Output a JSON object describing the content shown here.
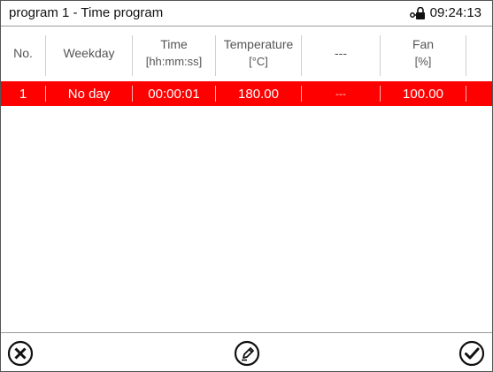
{
  "header": {
    "title": "program 1 - Time program",
    "time": "09:24:13",
    "lock_icon": "padlock-key-icon"
  },
  "table": {
    "columns": [
      {
        "label": "No.",
        "unit": ""
      },
      {
        "label": "Weekday",
        "unit": ""
      },
      {
        "label": "Time",
        "unit": "[hh:mm:ss]"
      },
      {
        "label": "Temperature",
        "unit": "[°C]"
      },
      {
        "label": "---",
        "unit": ""
      },
      {
        "label": "Fan",
        "unit": "[%]"
      }
    ],
    "rows": [
      {
        "no": "1",
        "weekday": "No day",
        "time": "00:00:01",
        "temperature": "180.00",
        "blank": "---",
        "fan": "100.00"
      }
    ],
    "selected_row_color": "#ff0000"
  },
  "footer": {
    "buttons": [
      "close-icon",
      "edit-icon",
      "confirm-icon"
    ]
  }
}
